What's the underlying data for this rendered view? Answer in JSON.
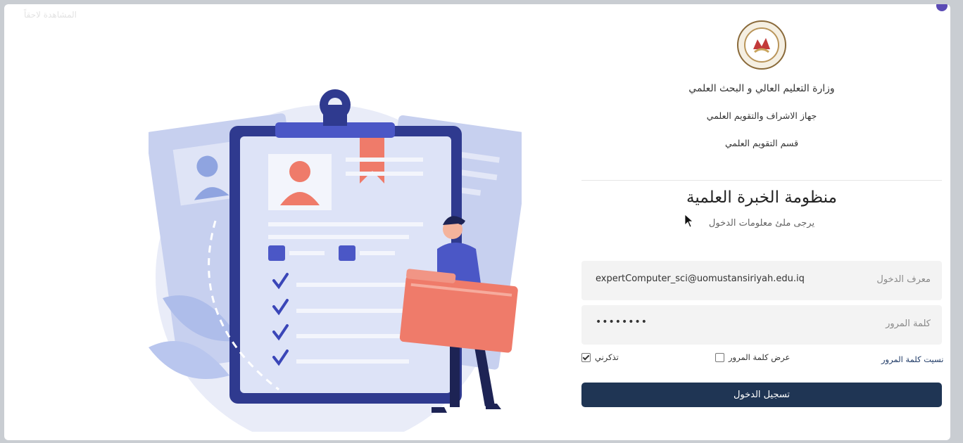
{
  "watermark": "المشاهدة لاحقاً",
  "header": {
    "ministry": "وزارة التعليم العالي و البحث العلمي",
    "agency": "جهاز الاشراف والتقويم العلمي",
    "department": "قسم التقويم العلمي"
  },
  "system": {
    "title": "منظومة الخبرة العلمية",
    "subtitle": "يرجى ملئ معلومات الدخول"
  },
  "form": {
    "username_label": "معرف الدخول",
    "username_value": "expertComputer_sci@uomustansiriyah.edu.iq",
    "password_label": "كلمة المرور",
    "password_value": "••••••••",
    "forgot_password": "نسيت كلمة المرور",
    "show_password": "عرض كلمة المرور",
    "show_password_checked": false,
    "remember_me": "تذكرني",
    "remember_me_checked": true,
    "login_button": "تسجيل الدخول"
  },
  "colors": {
    "primary": "#1f3554",
    "illustration_blue": "#2f3a8f",
    "illustration_salmon": "#ef7b6a",
    "illustration_bg": "#e7ebf7"
  },
  "icons": {
    "logo": "ministry-seal",
    "cursor": "mouse-pointer"
  }
}
